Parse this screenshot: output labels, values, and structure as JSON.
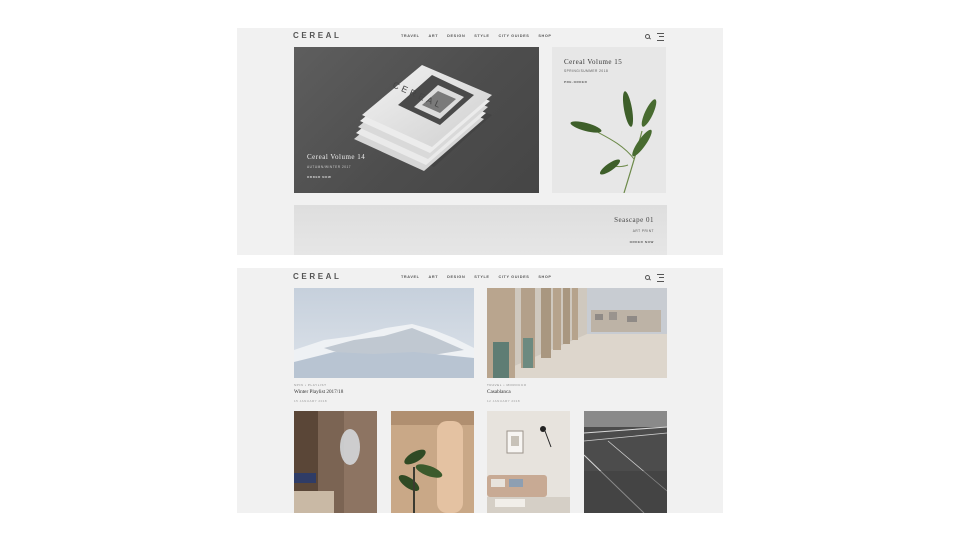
{
  "site": {
    "logo": "CEREAL",
    "nav": [
      "TRAVEL",
      "ART",
      "DESIGN",
      "STYLE",
      "CITY GUIDES",
      "SHOP"
    ]
  },
  "features": [
    {
      "title": "Cereal Volume 14",
      "subtitle": "AUTUMN/WINTER 2017",
      "link": "ORDER NOW"
    },
    {
      "title": "Cereal Volume 15",
      "subtitle": "SPRING/SUMMER 2018",
      "link": "PRE-ORDER"
    }
  ],
  "print": {
    "title": "Seascape 01",
    "subtitle": "ART PRINT",
    "link": "ORDER NOW"
  },
  "articles": [
    {
      "category": "SPIN • PLAYLIST",
      "title": "Winter Playlist 2017/18",
      "date": "15 JANUARY 2018"
    },
    {
      "category": "TRAVEL • MOROCCO",
      "title": "Casablanca",
      "date": "12 JANUARY 2018"
    }
  ],
  "colors": {
    "background": "#f1f1f1",
    "text": "#333333"
  }
}
